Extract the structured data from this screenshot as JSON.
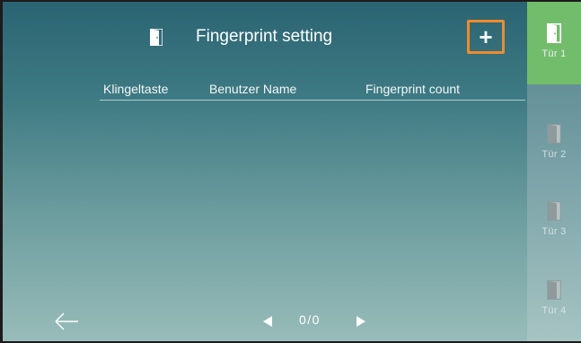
{
  "header": {
    "title": "Fingerprint setting",
    "icon": "door-icon",
    "add_button_label": "+",
    "add_button_icon": "plus-icon",
    "highlight_color": "#f08a2c"
  },
  "table": {
    "columns": [
      "Klingeltaste",
      "Benutzer Name",
      "Fingerprint count"
    ],
    "rows": []
  },
  "pagination": {
    "text": "0/0",
    "prev_icon": "triangle-left-icon",
    "next_icon": "triangle-right-icon"
  },
  "footer": {
    "back_icon": "arrow-left-icon"
  },
  "sidebar": {
    "active_color": "#72bd6c",
    "items": [
      {
        "label": "Tür 1",
        "icon": "door-open-icon",
        "active": true
      },
      {
        "label": "Tür 2",
        "icon": "door-closed-icon",
        "active": false
      },
      {
        "label": "Tür 3",
        "icon": "door-closed-icon",
        "active": false
      },
      {
        "label": "Tür 4",
        "icon": "door-closed-icon",
        "active": false
      }
    ]
  }
}
